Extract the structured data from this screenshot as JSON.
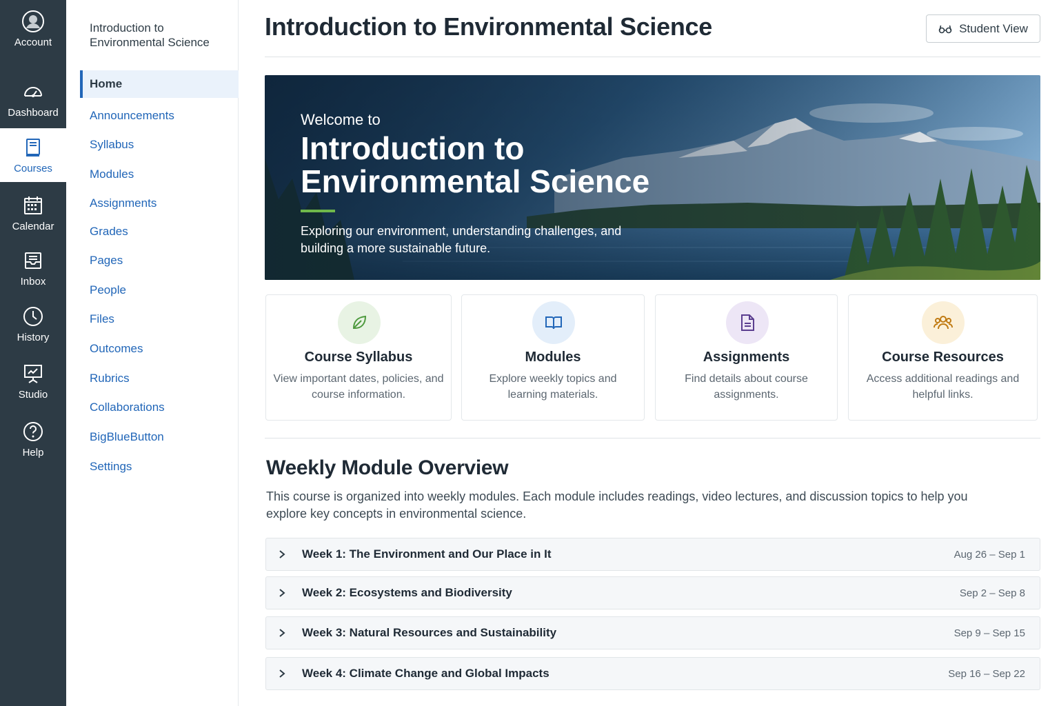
{
  "global_nav": {
    "items": [
      {
        "label": "Account",
        "icon": "user-circle-icon"
      },
      {
        "label": "Dashboard",
        "icon": "speedometer-icon"
      },
      {
        "label": "Courses",
        "icon": "book-icon"
      },
      {
        "label": "Calendar",
        "icon": "calendar-icon"
      },
      {
        "label": "Inbox",
        "icon": "inbox-icon"
      },
      {
        "label": "History",
        "icon": "clock-icon"
      },
      {
        "label": "Studio",
        "icon": "presentation-icon"
      },
      {
        "label": "Help",
        "icon": "help-circle-icon"
      }
    ]
  },
  "course_nav": {
    "title": "Introduction to Environmental Science",
    "items": [
      "Home",
      "Announcements",
      "Syllabus",
      "Modules",
      "Assignments",
      "Grades",
      "Pages",
      "People",
      "Files",
      "Outcomes",
      "Rubrics",
      "Collaborations",
      "BigBlueButton",
      "Settings"
    ]
  },
  "header": {
    "title": "Introduction to Environmental Science",
    "student_view_label": "Student View"
  },
  "hero": {
    "welcome": "Welcome to",
    "title": "Introduction to Environmental Science",
    "tagline": "Exploring our environment, understanding challenges, and building a more sustainable future."
  },
  "cards": [
    {
      "title": "Course Syllabus",
      "desc": "View important dates, policies, and course information.",
      "icon": "leaf-icon",
      "color": "#4e9a3e",
      "bg": "#e8f3e4"
    },
    {
      "title": "Modules",
      "desc": "Explore weekly topics and learning materials.",
      "icon": "open-book-icon",
      "color": "#2166b8",
      "bg": "#e3eefa"
    },
    {
      "title": "Assignments",
      "desc": "Find details about course assignments.",
      "icon": "document-icon",
      "color": "#5a3d8f",
      "bg": "#ede6f6"
    },
    {
      "title": "Course Resources",
      "desc": "Access additional readings and helpful links.",
      "icon": "people-icon",
      "color": "#c07a12",
      "bg": "#fbf0d9"
    }
  ],
  "weekly": {
    "heading": "Weekly Module Overview",
    "intro": "This course is organized into weekly modules. Each module includes readings, video lectures, and discussion topics to help you explore key concepts in environmental science.",
    "modules": [
      {
        "title": "Week 1: The Environment and Our Place in It",
        "dates": "Aug 26 – Sep 1"
      },
      {
        "title": "Week 2: Ecosystems and Biodiversity",
        "dates": "Sep 2 – Sep 8"
      },
      {
        "title": "Week 3: Natural Resources and Sustainability",
        "dates": "Sep 9 – Sep 15"
      },
      {
        "title": "Week 4: Climate Change and Global Impacts",
        "dates": "Sep 16 – Sep 22"
      }
    ]
  },
  "colors": {
    "nav_bg": "#2d3b45",
    "link": "#2166b8",
    "accent_green": "#6fb84b"
  }
}
